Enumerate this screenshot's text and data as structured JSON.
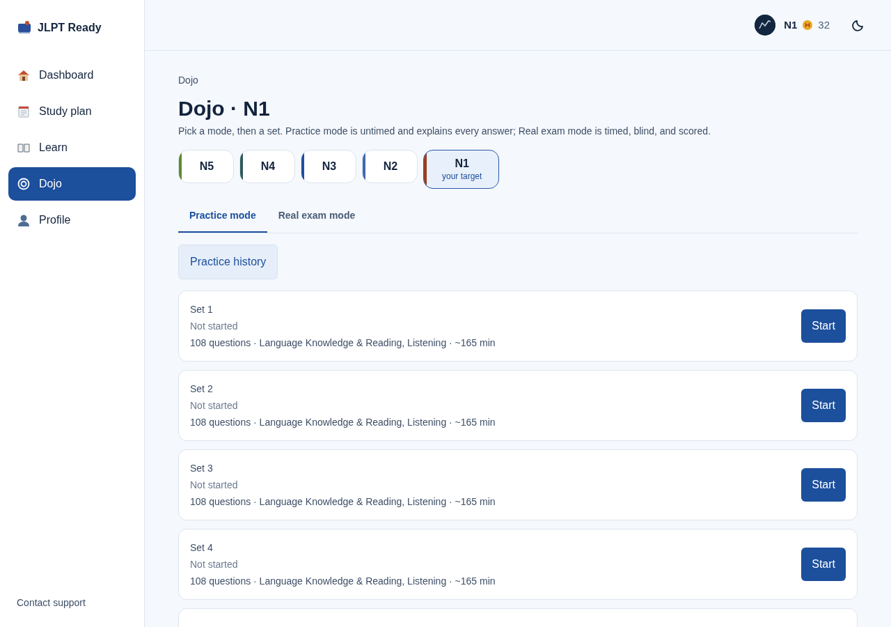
{
  "brand": {
    "name": "JLPT Ready"
  },
  "sidebar": {
    "items": [
      {
        "label": "Dashboard",
        "selected": false
      },
      {
        "label": "Study plan",
        "selected": false
      },
      {
        "label": "Learn",
        "selected": false
      },
      {
        "label": "Dojo",
        "selected": true
      },
      {
        "label": "Profile",
        "selected": false
      }
    ],
    "footer_link": "Contact support"
  },
  "header": {
    "level": "N1",
    "coins": "32"
  },
  "breadcrumb": "Dojo",
  "title": "Dojo · N1",
  "subtitle": "Pick a mode, then a set. Practice mode is untimed and explains every answer; Real exam mode is timed, blind, and scored.",
  "levels": [
    {
      "label": "N5",
      "color": "#5b8a2b",
      "selected": false
    },
    {
      "label": "N4",
      "color": "#2f5a5c",
      "selected": false
    },
    {
      "label": "N3",
      "color": "#1f4f9e",
      "selected": false
    },
    {
      "label": "N2",
      "color": "#4068b2",
      "selected": false
    },
    {
      "label": "N1",
      "note": "your target",
      "color": "#9b3d1f",
      "selected": true
    }
  ],
  "tabs": [
    {
      "label": "Practice mode",
      "selected": true
    },
    {
      "label": "Real exam mode",
      "selected": false
    }
  ],
  "history_button": "Practice history",
  "sets": [
    {
      "title": "Set 1",
      "status": "Not started",
      "details": "108 questions · Language Knowledge & Reading, Listening · ~165 min",
      "action": "Start"
    },
    {
      "title": "Set 2",
      "status": "Not started",
      "details": "108 questions · Language Knowledge & Reading, Listening · ~165 min",
      "action": "Start"
    },
    {
      "title": "Set 3",
      "status": "Not started",
      "details": "108 questions · Language Knowledge & Reading, Listening · ~165 min",
      "action": "Start"
    },
    {
      "title": "Set 4",
      "status": "Not started",
      "details": "108 questions · Language Knowledge & Reading, Listening · ~165 min",
      "action": "Start"
    }
  ],
  "more_sets_below": true
}
